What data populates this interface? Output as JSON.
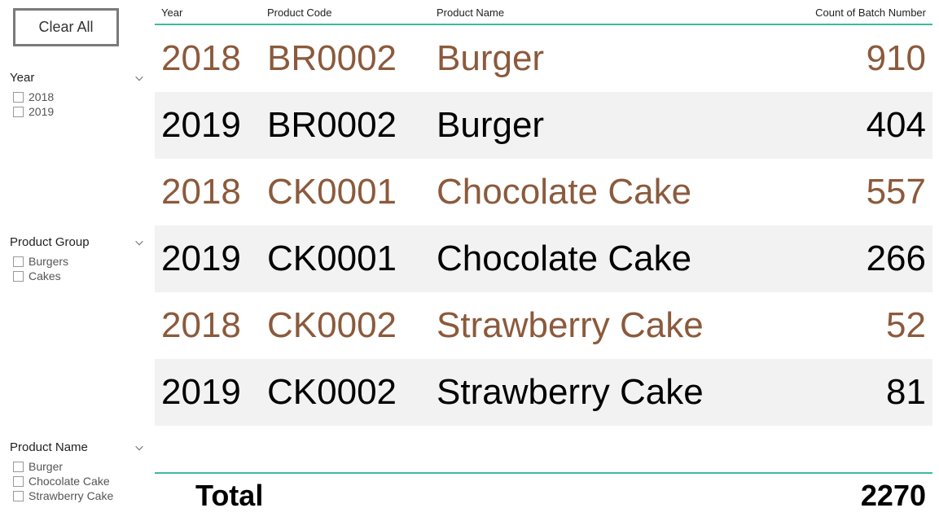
{
  "sidebar": {
    "clear_all_label": "Clear All",
    "slicers": [
      {
        "title": "Year",
        "items": [
          "2018",
          "2019"
        ]
      },
      {
        "title": "Product Group",
        "items": [
          "Burgers",
          "Cakes"
        ]
      },
      {
        "title": "Product Name",
        "items": [
          "Burger",
          "Chocolate Cake",
          "Strawberry Cake"
        ]
      }
    ]
  },
  "table": {
    "headers": {
      "year": "Year",
      "code": "Product Code",
      "name": "Product Name",
      "count": "Count of Batch Number"
    },
    "rows": [
      {
        "year": "2018",
        "code": "BR0002",
        "name": "Burger",
        "count": "910",
        "highlight": true,
        "even": false
      },
      {
        "year": "2019",
        "code": "BR0002",
        "name": "Burger",
        "count": "404",
        "highlight": false,
        "even": true
      },
      {
        "year": "2018",
        "code": "CK0001",
        "name": "Chocolate Cake",
        "count": "557",
        "highlight": true,
        "even": false
      },
      {
        "year": "2019",
        "code": "CK0001",
        "name": "Chocolate Cake",
        "count": "266",
        "highlight": false,
        "even": true
      },
      {
        "year": "2018",
        "code": "CK0002",
        "name": "Strawberry Cake",
        "count": "52",
        "highlight": true,
        "even": false
      },
      {
        "year": "2019",
        "code": "CK0002",
        "name": "Strawberry Cake",
        "count": "81",
        "highlight": false,
        "even": true
      }
    ],
    "footer": {
      "label": "Total",
      "value": "2270"
    }
  }
}
